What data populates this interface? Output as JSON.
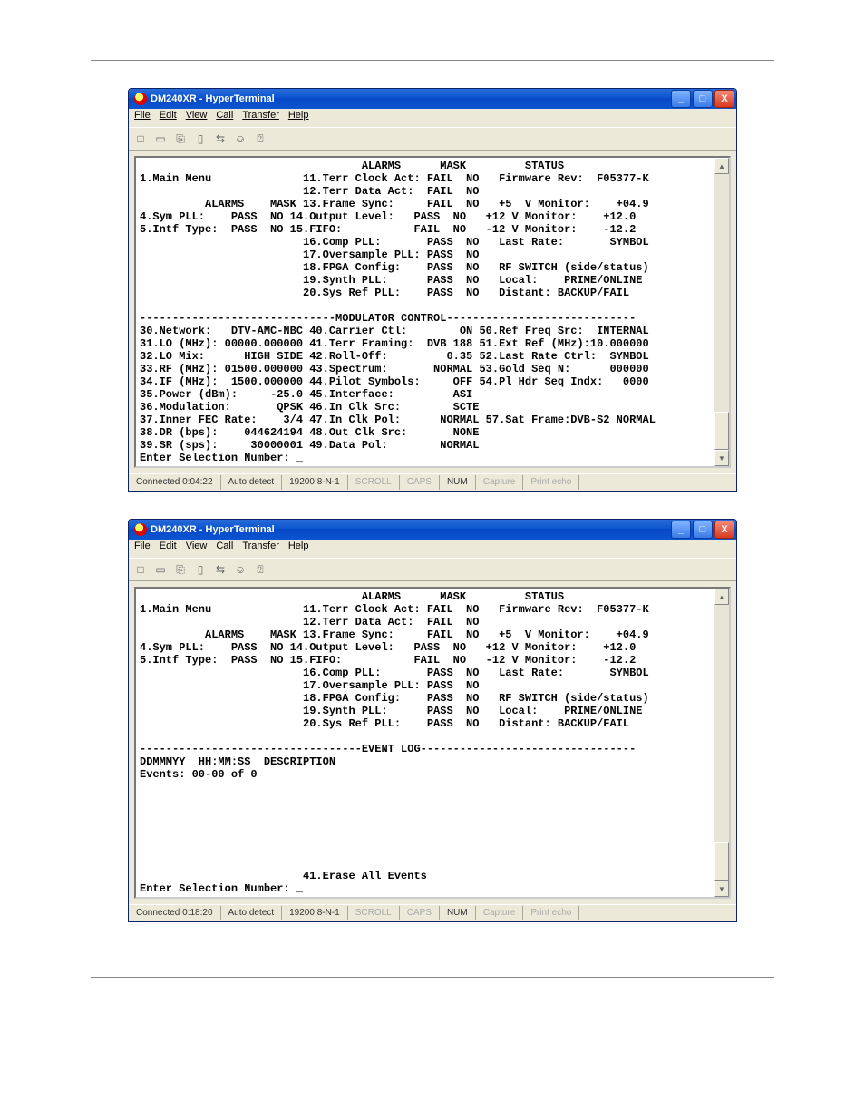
{
  "window": {
    "title": "DM240XR - HyperTerminal",
    "caps": {
      "min": "_",
      "max": "□",
      "close": "X"
    },
    "menus": [
      "File",
      "Edit",
      "View",
      "Call",
      "Transfer",
      "Help"
    ],
    "toolbar": [
      "□",
      "▭",
      "⎘",
      "▯",
      "⇆",
      "⎉",
      "⍰"
    ]
  },
  "status1": {
    "conn": "Connected 0:04:22",
    "detect": "Auto detect",
    "rate": "19200 8-N-1",
    "scroll": "SCROLL",
    "caps": "CAPS",
    "num": "NUM",
    "capture": "Capture",
    "print": "Print echo"
  },
  "status2": {
    "conn": "Connected 0:18:20",
    "detect": "Auto detect",
    "rate": "19200 8-N-1",
    "scroll": "SCROLL",
    "caps": "CAPS",
    "num": "NUM",
    "capture": "Capture",
    "print": "Print echo"
  },
  "term1": "                                  ALARMS      MASK         STATUS\n1.Main Menu              11.Terr Clock Act: FAIL  NO   Firmware Rev:  F05377-K\n                         12.Terr Data Act:  FAIL  NO\n          ALARMS    MASK 13.Frame Sync:     FAIL  NO   +5  V Monitor:    +04.9\n4.Sym PLL:    PASS  NO 14.Output Level:   PASS  NO   +12 V Monitor:    +12.0\n5.Intf Type:  PASS  NO 15.FIFO:           FAIL  NO   -12 V Monitor:    -12.2\n                         16.Comp PLL:       PASS  NO   Last Rate:       SYMBOL\n                         17.Oversample PLL: PASS  NO\n                         18.FPGA Config:    PASS  NO   RF SWITCH (side/status)\n                         19.Synth PLL:      PASS  NO   Local:    PRIME/ONLINE\n                         20.Sys Ref PLL:    PASS  NO   Distant: BACKUP/FAIL\n\n------------------------------MODULATOR CONTROL-----------------------------\n30.Network:   DTV-AMC-NBC 40.Carrier Ctl:        ON 50.Ref Freq Src:  INTERNAL\n31.LO (MHz): 00000.000000 41.Terr Framing:  DVB 188 51.Ext Ref (MHz):10.000000\n32.LO Mix:      HIGH SIDE 42.Roll-Off:         0.35 52.Last Rate Ctrl:  SYMBOL\n33.RF (MHz): 01500.000000 43.Spectrum:       NORMAL 53.Gold Seq N:      000000\n34.IF (MHz):  1500.000000 44.Pilot Symbols:     OFF 54.Pl Hdr Seq Indx:   0000\n35.Power (dBm):     -25.0 45.Interface:         ASI\n36.Modulation:       QPSK 46.In Clk Src:        SCTE\n37.Inner FEC Rate:    3/4 47.In Clk Pol:      NORMAL 57.Sat Frame:DVB-S2 NORMAL\n38.DR (bps):    044624194 48.Out Clk Src:       NONE\n39.SR (sps):     30000001 49.Data Pol:        NORMAL\nEnter Selection Number: _",
  "term2": "                                  ALARMS      MASK         STATUS\n1.Main Menu              11.Terr Clock Act: FAIL  NO   Firmware Rev:  F05377-K\n                         12.Terr Data Act:  FAIL  NO\n          ALARMS    MASK 13.Frame Sync:     FAIL  NO   +5  V Monitor:    +04.9\n4.Sym PLL:    PASS  NO 14.Output Level:   PASS  NO   +12 V Monitor:    +12.0\n5.Intf Type:  PASS  NO 15.FIFO:           FAIL  NO   -12 V Monitor:    -12.2\n                         16.Comp PLL:       PASS  NO   Last Rate:       SYMBOL\n                         17.Oversample PLL: PASS  NO\n                         18.FPGA Config:    PASS  NO   RF SWITCH (side/status)\n                         19.Synth PLL:      PASS  NO   Local:    PRIME/ONLINE\n                         20.Sys Ref PLL:    PASS  NO   Distant: BACKUP/FAIL\n\n----------------------------------EVENT LOG---------------------------------\nDDMMMYY  HH:MM:SS  DESCRIPTION\nEvents: 00-00 of 0\n\n\n\n\n\n\n\n                         41.Erase All Events\nEnter Selection Number: _"
}
